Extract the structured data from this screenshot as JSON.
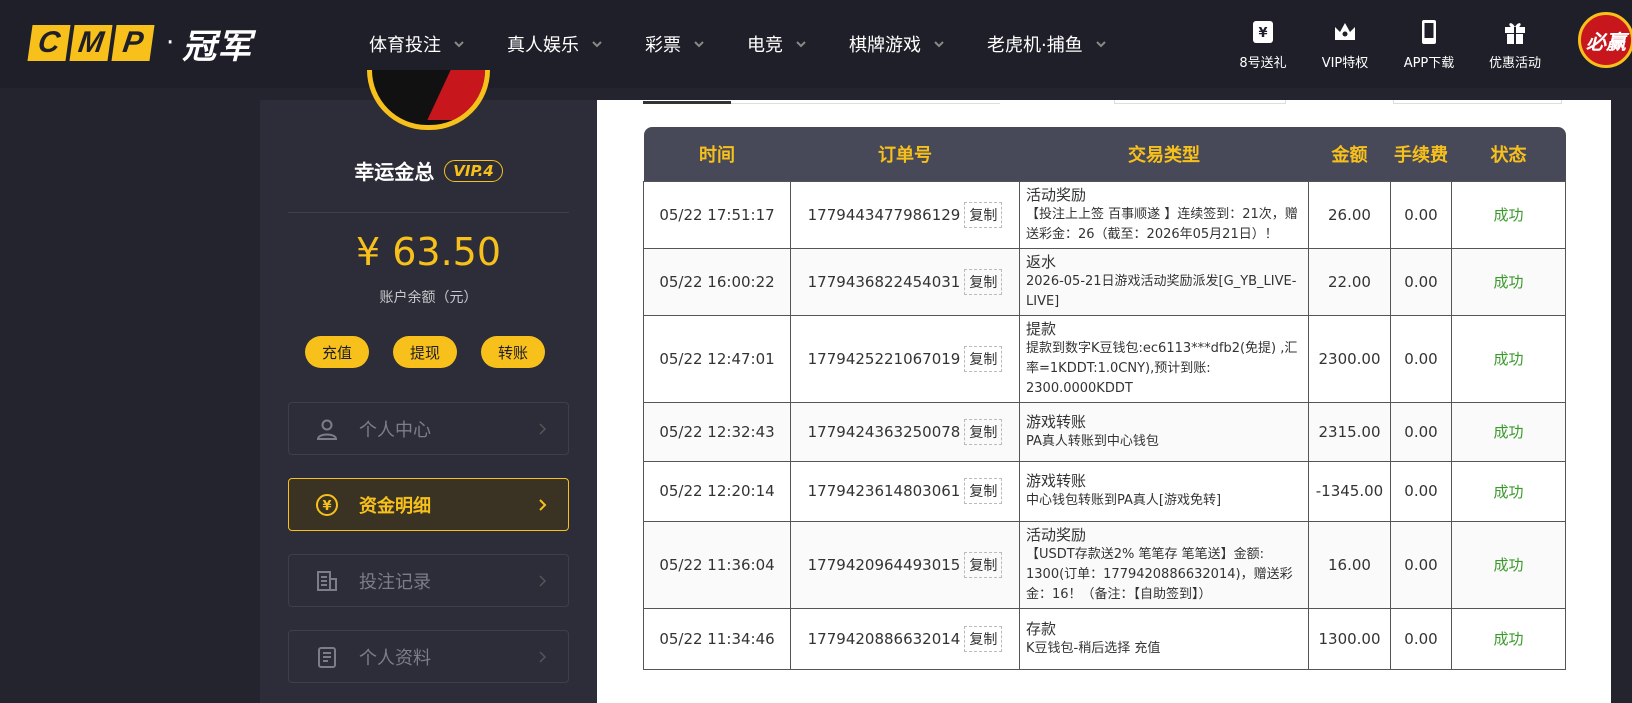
{
  "header": {
    "logo_letters": [
      "C",
      "M",
      "P"
    ],
    "logo_sep": "·",
    "logo_cn": "冠军",
    "nav": [
      {
        "label": "体育投注"
      },
      {
        "label": "真人娱乐"
      },
      {
        "label": "彩票"
      },
      {
        "label": "电竞"
      },
      {
        "label": "棋牌游戏"
      },
      {
        "label": "老虎机·捕鱼"
      }
    ],
    "quick_links": [
      {
        "label": "8号送礼",
        "icon": "gift-voucher-icon"
      },
      {
        "label": "VIP特权",
        "icon": "crown-icon"
      },
      {
        "label": "APP下载",
        "icon": "phone-icon"
      },
      {
        "label": "优惠活动",
        "icon": "gift-box-icon"
      }
    ],
    "avatar_text": "必赢"
  },
  "sidebar": {
    "username": "幸运金总",
    "vip": "VIP.4",
    "balance": "¥ 63.50",
    "balance_label": "账户余额（元）",
    "actions": [
      "充值",
      "提现",
      "转账"
    ],
    "menu": [
      {
        "label": "个人中心",
        "icon": "user-icon"
      },
      {
        "label": "资金明细",
        "icon": "yen-coin-icon",
        "active": true
      },
      {
        "label": "投注记录",
        "icon": "receipt-icon"
      },
      {
        "label": "个人资料",
        "icon": "document-icon"
      }
    ]
  },
  "table": {
    "headers": [
      "时间",
      "订单号",
      "交易类型",
      "金额",
      "手续费",
      "状态"
    ],
    "copy_label": "复制",
    "rows": [
      {
        "time": "05/22 17:51:17",
        "order": "1779443477986129",
        "type_title": "活动奖励",
        "type_desc": "【投注上上签 百事顺遂 】连续签到：21次，赠送彩金：26（截至：2026年05月21日）！",
        "amount": "26.00",
        "fee": "0.00",
        "status": "成功"
      },
      {
        "time": "05/22 16:00:22",
        "order": "1779436822454031",
        "type_title": "返水",
        "type_desc": "2026-05-21日游戏活动奖励派发[G_YB_LIVE-LIVE]",
        "amount": "22.00",
        "fee": "0.00",
        "status": "成功"
      },
      {
        "time": "05/22 12:47:01",
        "order": "1779425221067019",
        "type_title": "提款",
        "type_desc": "提款到数字K豆钱包:ec6113***dfb2(免提) ,汇率=1KDDT:1.0CNY),预计到账: 2300.0000KDDT",
        "amount": "2300.00",
        "fee": "0.00",
        "status": "成功"
      },
      {
        "time": "05/22 12:32:43",
        "order": "1779424363250078",
        "type_title": "游戏转账",
        "type_desc": "PA真人转账到中心钱包",
        "amount": "2315.00",
        "fee": "0.00",
        "status": "成功"
      },
      {
        "time": "05/22 12:20:14",
        "order": "1779423614803061",
        "type_title": "游戏转账",
        "type_desc": "中心钱包转账到PA真人[游戏免转]",
        "amount": "-1345.00",
        "fee": "0.00",
        "status": "成功"
      },
      {
        "time": "05/22 11:36:04",
        "order": "1779420964493015",
        "type_title": "活动奖励",
        "type_desc": "【USDT存款送2% 笔笔存 笔笔送】金额: 1300(订单：1779420886632014)，赠送彩金：16！（备注：【自助签到】）",
        "amount": "16.00",
        "fee": "0.00",
        "status": "成功"
      },
      {
        "time": "05/22 11:34:46",
        "order": "1779420886632014",
        "type_title": "存款",
        "type_desc": "K豆钱包-稍后选择 充值",
        "amount": "1300.00",
        "fee": "0.00",
        "status": "成功"
      }
    ]
  },
  "colors": {
    "accent": "#f8c01b",
    "header_bg": "#1e1f28",
    "sidebar_bg": "#2c2d38",
    "success": "#3b9a2c"
  }
}
